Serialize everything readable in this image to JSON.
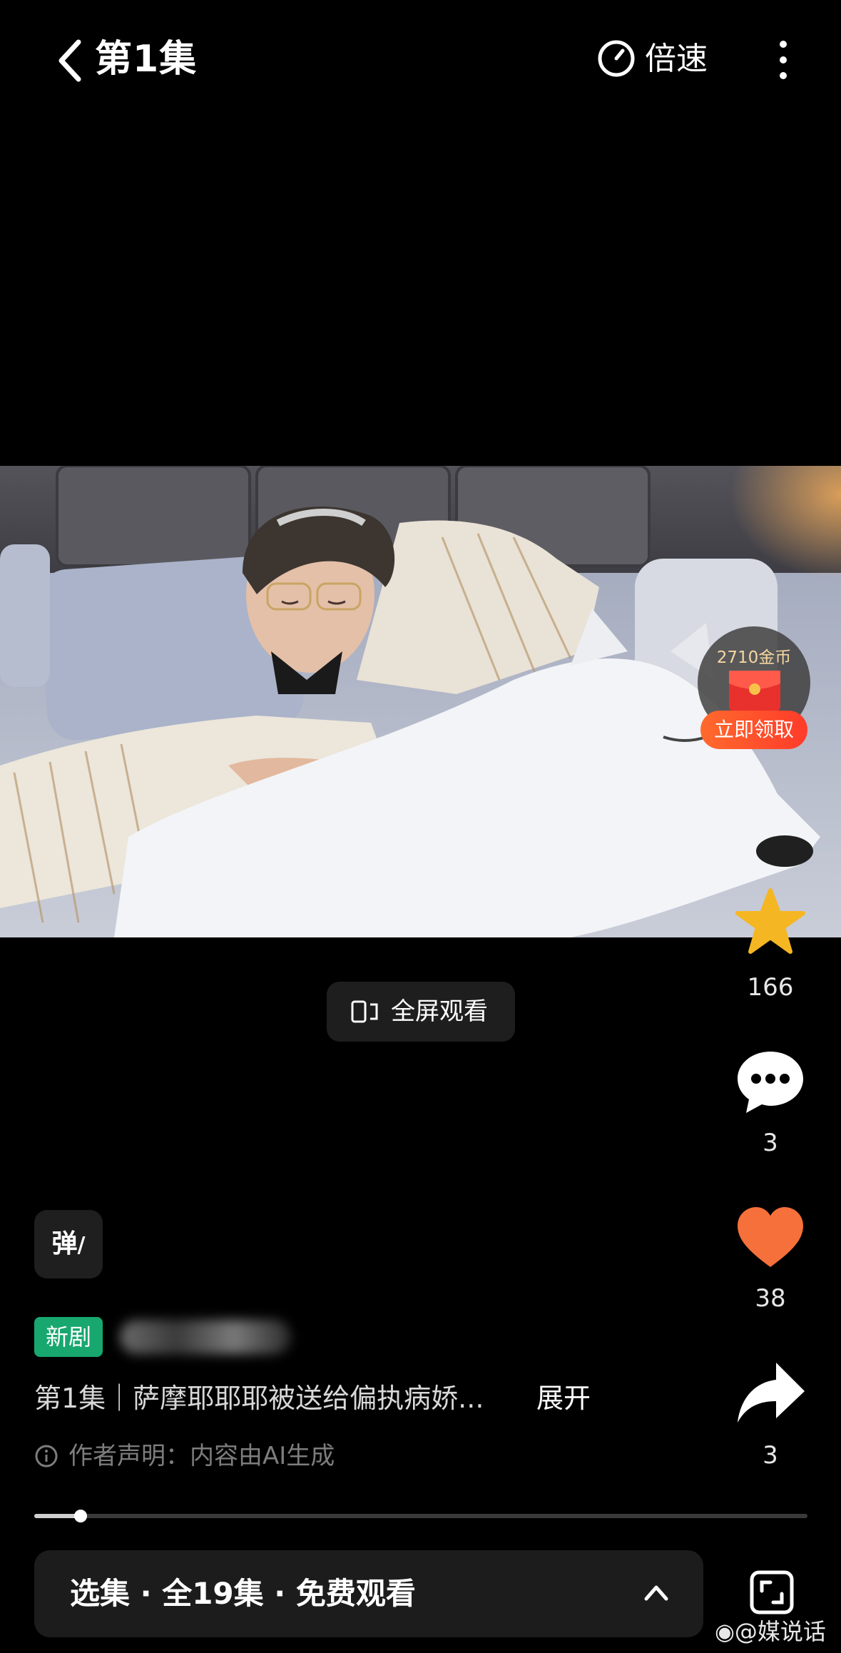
{
  "header": {
    "title": "第1集",
    "speed_label": "倍速"
  },
  "reward": {
    "amount": "2710金币",
    "button": "立即领取"
  },
  "fullscreen": {
    "label": "全屏观看"
  },
  "rail": {
    "favorite_count": "166",
    "comment_count": "3",
    "like_count": "38",
    "share_count": "3"
  },
  "danmu": {
    "label": "弹"
  },
  "info": {
    "tag": "新剧",
    "description": "第1集｜萨摩耶耶耶被送给偏执病娇...",
    "expand": "展开",
    "statement": "作者声明：内容由AI生成"
  },
  "progress": {
    "fraction": 0.06
  },
  "bottom": {
    "episodes_label": "选集 · 全19集 · 免费观看"
  },
  "watermark": {
    "text": "@媒说话"
  },
  "colors": {
    "tag_green": "#18a76f",
    "star": "#f5b623",
    "heart": "#f5703a",
    "reward_red": "#ff4a2a"
  }
}
